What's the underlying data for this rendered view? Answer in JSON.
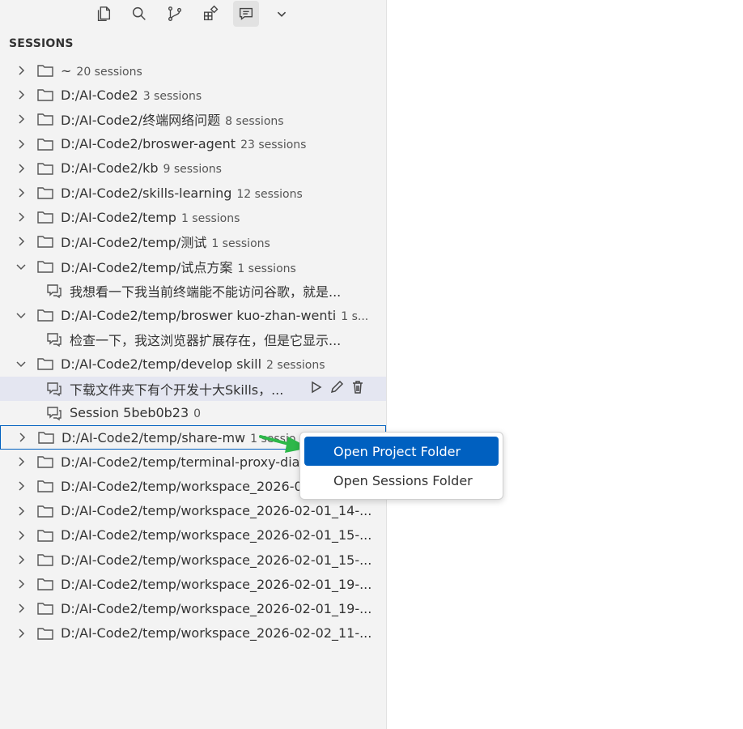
{
  "toolbar": {
    "icons": [
      "explorer-icon",
      "search-icon",
      "source-control-icon",
      "extensions-icon",
      "chat-sessions-icon",
      "chevron-down-icon"
    ]
  },
  "section_title": "SESSIONS",
  "tree": [
    {
      "kind": "folder",
      "label": "~",
      "count": "20 sessions",
      "expanded": false
    },
    {
      "kind": "folder",
      "label": "D:/AI-Code2",
      "count": "3 sessions",
      "expanded": false
    },
    {
      "kind": "folder",
      "label": "D:/AI-Code2/终端网络问题",
      "count": "8 sessions",
      "expanded": false
    },
    {
      "kind": "folder",
      "label": "D:/AI-Code2/broswer-agent",
      "count": "23 sessions",
      "expanded": false
    },
    {
      "kind": "folder",
      "label": "D:/AI-Code2/kb",
      "count": "9 sessions",
      "expanded": false
    },
    {
      "kind": "folder",
      "label": "D:/AI-Code2/skills-learning",
      "count": "12 sessions",
      "expanded": false
    },
    {
      "kind": "folder",
      "label": "D:/AI-Code2/temp",
      "count": "1 sessions",
      "expanded": false
    },
    {
      "kind": "folder",
      "label": "D:/AI-Code2/temp/测试",
      "count": "1 sessions",
      "expanded": false
    },
    {
      "kind": "folder",
      "label": "D:/AI-Code2/temp/试点方案",
      "count": "1 sessions",
      "expanded": true
    },
    {
      "kind": "session",
      "label": "我想看一下我当前终端能不能访问谷歌，就是...",
      "count": ""
    },
    {
      "kind": "folder",
      "label": "D:/AI-Code2/temp/broswer kuo-zhan-wenti",
      "count": "1 s...",
      "expanded": true
    },
    {
      "kind": "session",
      "label": "检查一下，我这浏览器扩展存在，但是它显示...",
      "count": ""
    },
    {
      "kind": "folder",
      "label": "D:/AI-Code2/temp/develop skill",
      "count": "2 sessions",
      "expanded": true
    },
    {
      "kind": "session",
      "label": "下载文件夹下有个开发十大Skills，...",
      "count": "",
      "selected": true
    },
    {
      "kind": "session",
      "label": "Session 5beb0b23",
      "count": "0"
    },
    {
      "kind": "folder",
      "label": "D:/AI-Code2/temp/share-mw",
      "count": "1 sessio",
      "expanded": false,
      "focused": true
    },
    {
      "kind": "folder",
      "label": "D:/AI-Code2/temp/terminal-proxy-dia",
      "count": "",
      "expanded": false
    },
    {
      "kind": "folder",
      "label": "D:/AI-Code2/temp/workspace_2026-0",
      "count": "",
      "expanded": false
    },
    {
      "kind": "folder",
      "label": "D:/AI-Code2/temp/workspace_2026-02-01_14-...",
      "count": "",
      "expanded": false
    },
    {
      "kind": "folder",
      "label": "D:/AI-Code2/temp/workspace_2026-02-01_15-...",
      "count": "",
      "expanded": false
    },
    {
      "kind": "folder",
      "label": "D:/AI-Code2/temp/workspace_2026-02-01_15-...",
      "count": "",
      "expanded": false
    },
    {
      "kind": "folder",
      "label": "D:/AI-Code2/temp/workspace_2026-02-01_19-...",
      "count": "",
      "expanded": false
    },
    {
      "kind": "folder",
      "label": "D:/AI-Code2/temp/workspace_2026-02-01_19-...",
      "count": "",
      "expanded": false
    },
    {
      "kind": "folder",
      "label": "D:/AI-Code2/temp/workspace_2026-02-02_11-...",
      "count": "",
      "expanded": false
    }
  ],
  "context_menu": {
    "items": [
      {
        "label": "Open Project Folder",
        "active": true
      },
      {
        "label": "Open Sessions Folder",
        "active": false
      }
    ]
  },
  "colors": {
    "accent": "#0060c0",
    "arrow": "#2db84a",
    "selected_row": "#e4e6f1"
  }
}
